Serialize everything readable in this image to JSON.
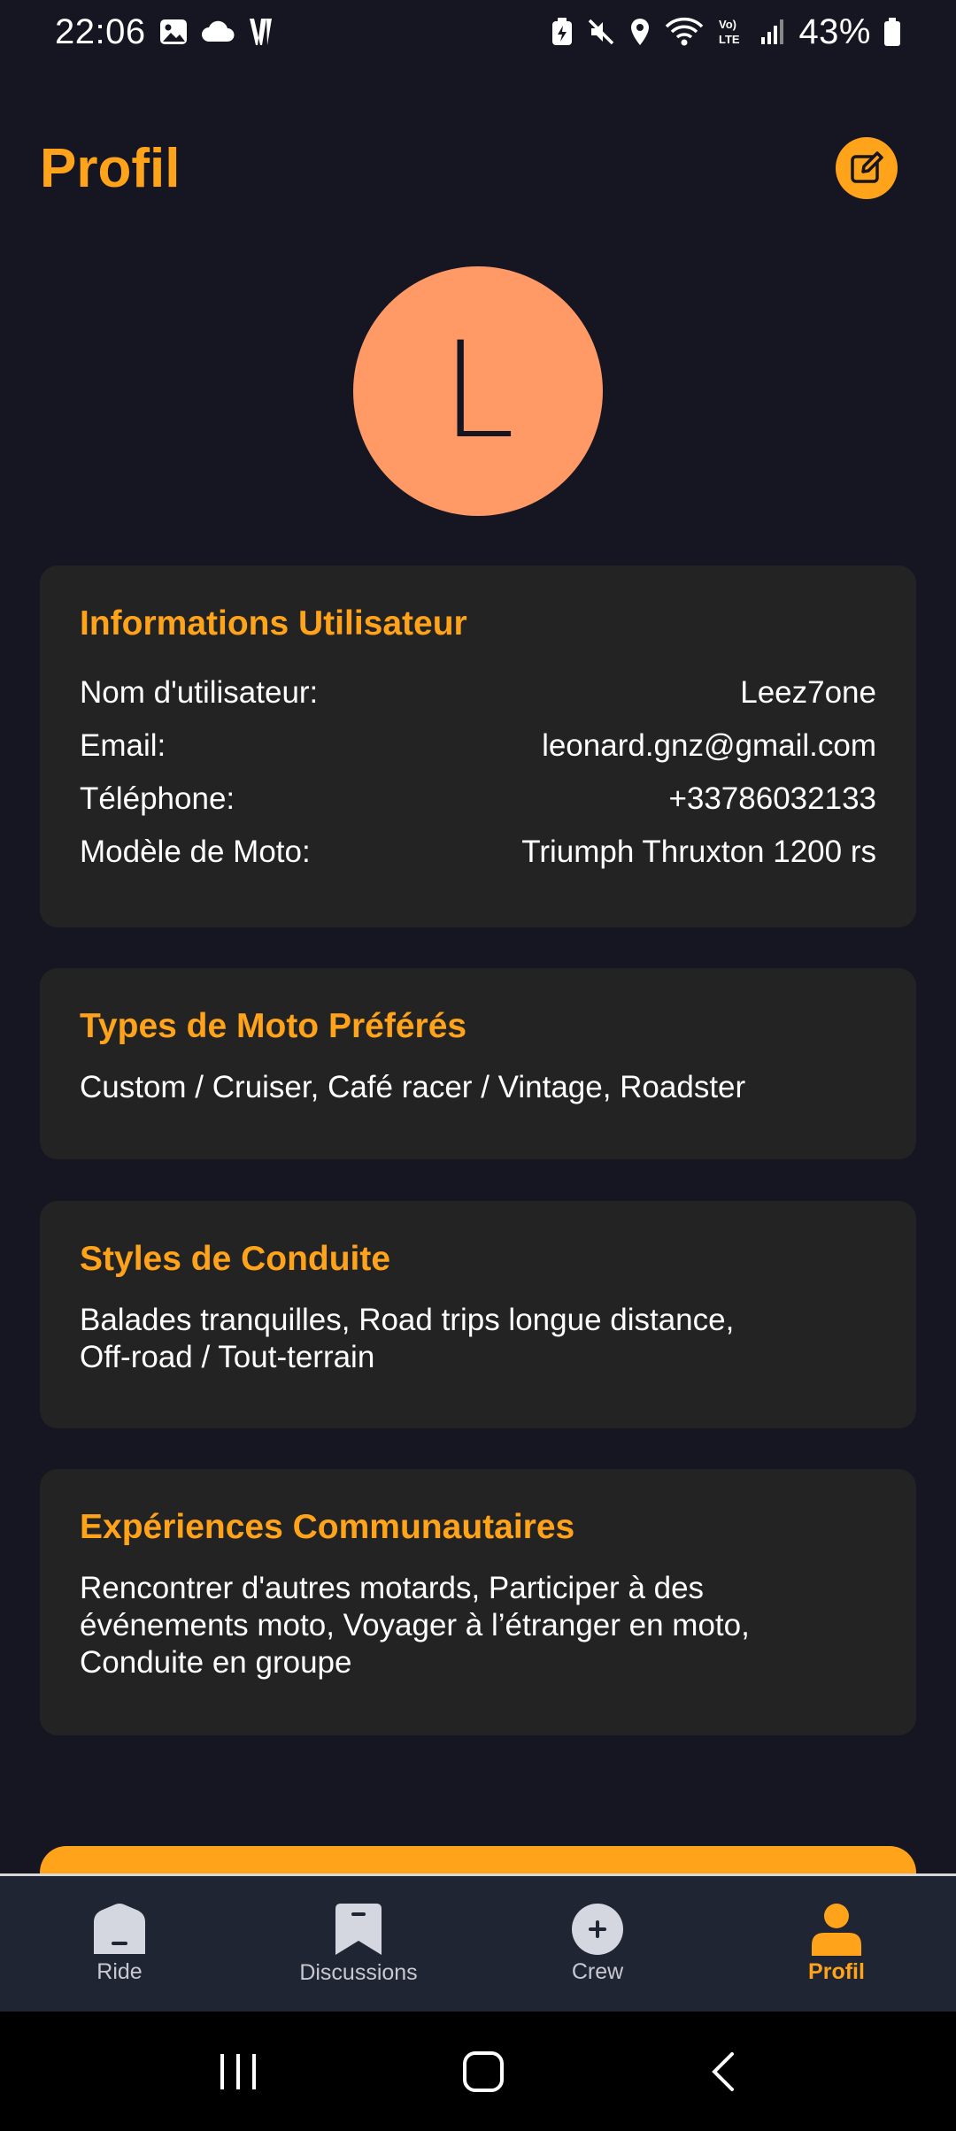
{
  "status_bar": {
    "time": "22:06",
    "battery": "43%",
    "network_label": "Vo) LTE"
  },
  "header": {
    "title": "Profil",
    "edit_icon": "edit-icon"
  },
  "avatar": {
    "initial": "L",
    "color": "#ff9966"
  },
  "user_info": {
    "title": "Informations Utilisateur",
    "rows": [
      {
        "label": "Nom d'utilisateur:",
        "value": "Leez7one"
      },
      {
        "label": "Email:",
        "value": "leonard.gnz@gmail.com"
      },
      {
        "label": "Téléphone:",
        "value": "+33786032133"
      },
      {
        "label": "Modèle de Moto:",
        "value": "Triumph Thruxton 1200 rs"
      }
    ]
  },
  "bike_types": {
    "title": "Types de Moto Préférés",
    "text": "Custom / Cruiser, Café racer / Vintage, Roadster"
  },
  "riding_styles": {
    "title": "Styles de Conduite",
    "text": "Balades tranquilles, Road trips longue distance, Off-road / Tout-terrain"
  },
  "community": {
    "title": "Expériences Communautaires",
    "text": "Rencontrer d'autres motards, Participer à des événements moto, Voyager à l’étranger en moto, Conduite en groupe"
  },
  "nav": {
    "items": [
      {
        "label": "Ride",
        "icon": "ride-icon",
        "active": false
      },
      {
        "label": "Discussions",
        "icon": "bookmark-icon",
        "active": false
      },
      {
        "label": "Crew",
        "icon": "plus-circle-icon",
        "active": false
      },
      {
        "label": "Profil",
        "icon": "person-icon",
        "active": true
      }
    ]
  },
  "colors": {
    "accent": "#ffa31a",
    "background": "#161622",
    "card": "#232323",
    "nav_background": "#1f2533"
  }
}
